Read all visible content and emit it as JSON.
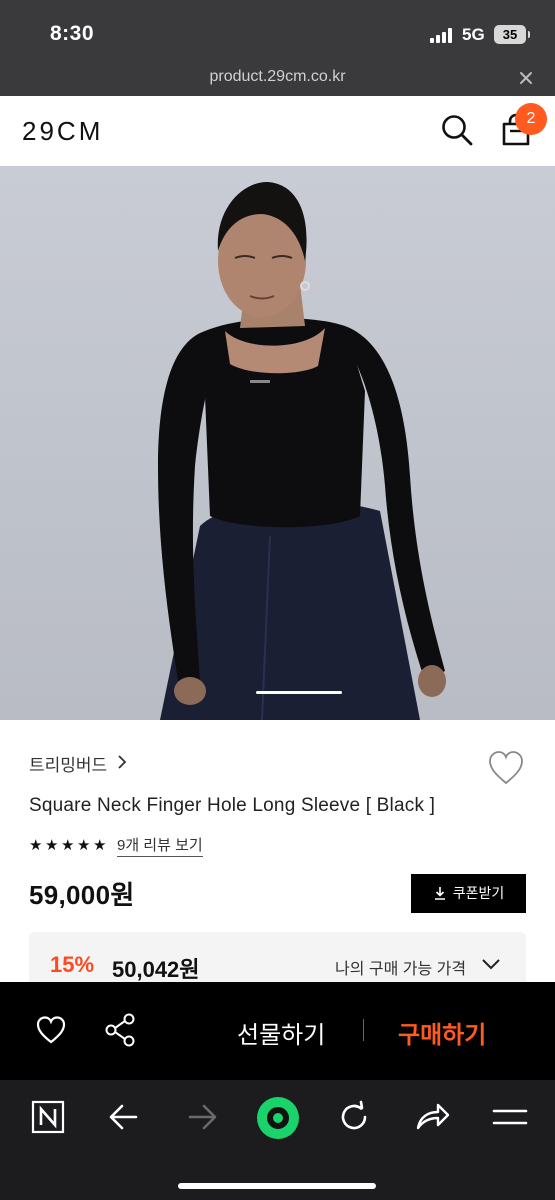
{
  "status_bar": {
    "time": "8:30",
    "network": "5G",
    "battery": "35"
  },
  "url_bar": {
    "url": "product.29cm.co.kr"
  },
  "header": {
    "logo": "29CM",
    "cart_count": "2"
  },
  "product": {
    "brand": "트리밍버드",
    "name": "Square Neck Finger Hole Long Sleeve [ Black ]",
    "rating_stars": 5,
    "review_link": "9개 리뷰 보기",
    "price": "59,000원",
    "coupon_label": "쿠폰받기",
    "discount_rate": "15%",
    "discount_price": "50,042원",
    "discount_label": "나의 구매 가능 가격"
  },
  "actions": {
    "gift_label": "선물하기",
    "buy_label": "구매하기"
  },
  "colors": {
    "accent": "#ff5a1f",
    "badge": "#ff5a1f",
    "browser_home": "#18d46a"
  },
  "icons": [
    "search-icon",
    "cart-icon",
    "heart-icon",
    "share-icon",
    "download-icon",
    "chevron-down-icon",
    "close-icon",
    "back-icon",
    "forward-icon",
    "reload-icon",
    "share-arrow-icon",
    "menu-icon",
    "naver-icon",
    "home-dot-icon"
  ]
}
